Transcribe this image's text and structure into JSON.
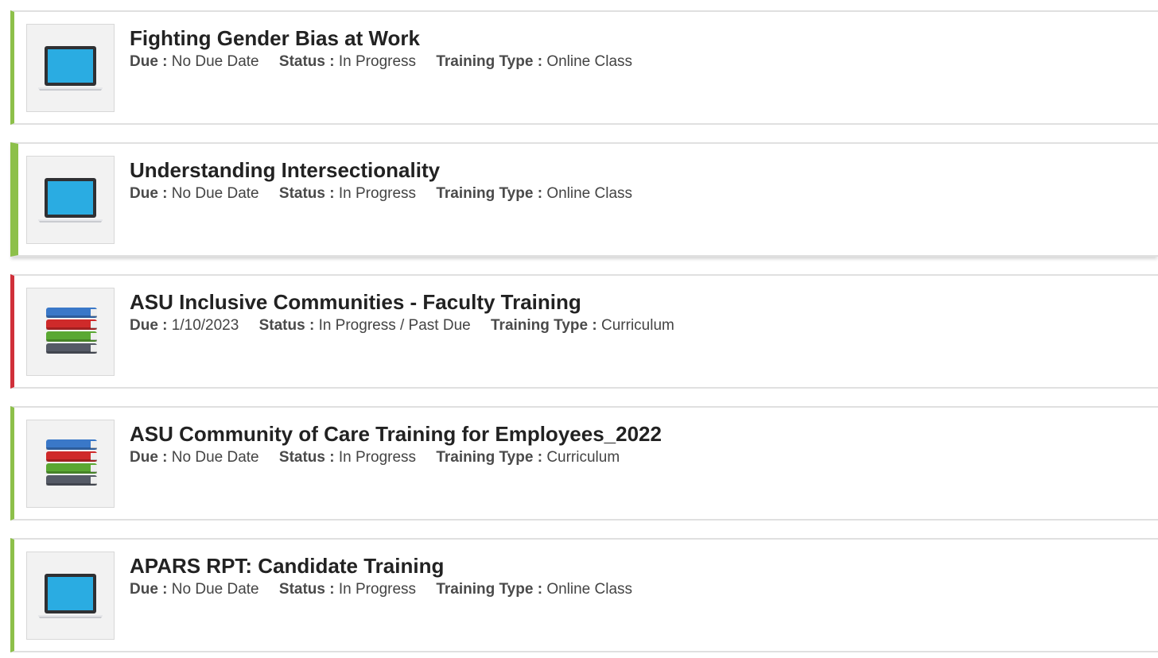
{
  "labels": {
    "due": "Due :",
    "status": "Status :",
    "training_type": "Training Type :"
  },
  "colors": {
    "accent_ok": "#8dc04a",
    "accent_past_due": "#d0303a",
    "laptop_screen": "#2aace2",
    "book_blue": "#3a78c8",
    "book_red": "#cf2a2a",
    "book_green": "#5aa832",
    "book_gray": "#555a66"
  },
  "trainings": [
    {
      "title": "Fighting Gender Bias at Work",
      "due": "No Due Date",
      "status": "In Progress",
      "type": "Online Class",
      "icon": "laptop-icon",
      "past_due": false,
      "selected": false
    },
    {
      "title": "Understanding Intersectionality",
      "due": "No Due Date",
      "status": "In Progress",
      "type": "Online Class",
      "icon": "laptop-icon",
      "past_due": false,
      "selected": true
    },
    {
      "title": "ASU Inclusive Communities - Faculty Training",
      "due": "1/10/2023",
      "status": "In Progress / Past Due",
      "type": "Curriculum",
      "icon": "books-icon",
      "past_due": true,
      "selected": false
    },
    {
      "title": "ASU Community of Care Training for Employees_2022",
      "due": "No Due Date",
      "status": "In Progress",
      "type": "Curriculum",
      "icon": "books-icon",
      "past_due": false,
      "selected": false
    },
    {
      "title": "APARS RPT: Candidate Training",
      "due": "No Due Date",
      "status": "In Progress",
      "type": "Online Class",
      "icon": "laptop-icon",
      "past_due": false,
      "selected": false
    }
  ]
}
